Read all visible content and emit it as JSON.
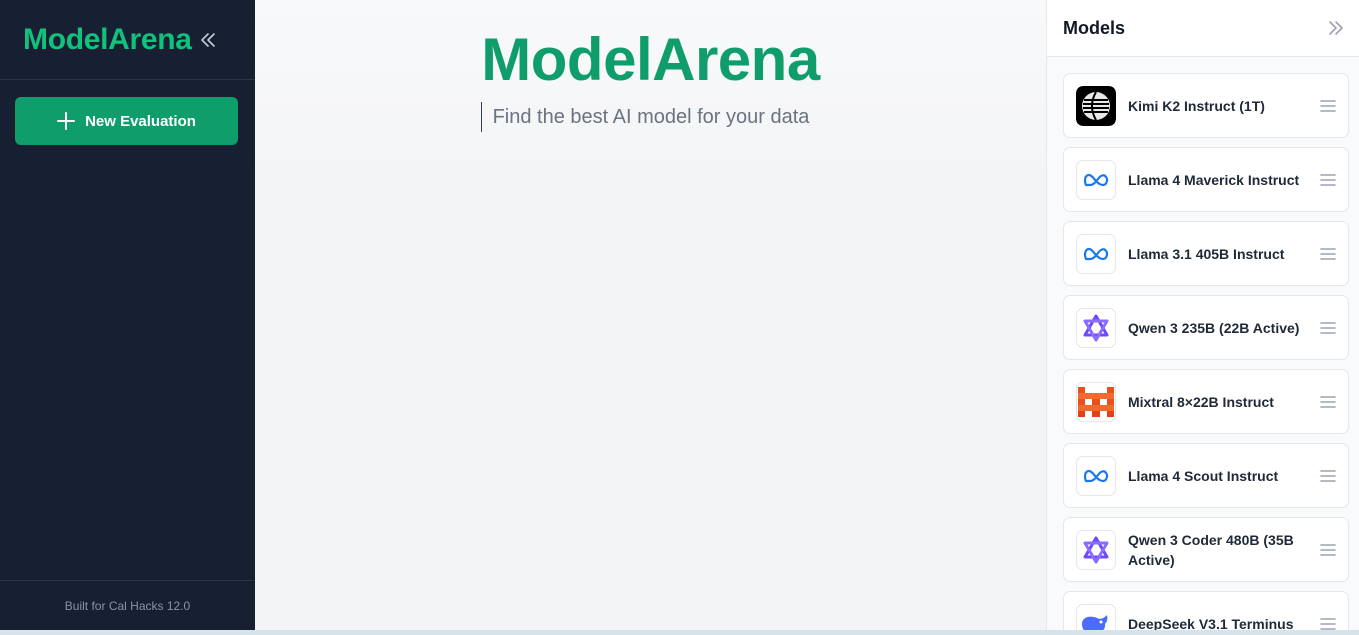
{
  "sidebar": {
    "brand": "ModelArena",
    "new_evaluation_label": "New Evaluation",
    "footer": "Built for Cal Hacks 12.0"
  },
  "main": {
    "title": "ModelArena",
    "search_placeholder": "Find the best AI model for your data"
  },
  "models_panel": {
    "title": "Models",
    "models": [
      {
        "name": "Kimi K2 Instruct (1T)",
        "icon": "kimi-icon"
      },
      {
        "name": "Llama 4 Maverick Instruct",
        "icon": "meta-icon"
      },
      {
        "name": "Llama 3.1 405B Instruct",
        "icon": "meta-icon"
      },
      {
        "name": "Qwen 3 235B (22B Active)",
        "icon": "qwen-icon"
      },
      {
        "name": "Mixtral 8×22B Instruct",
        "icon": "mistral-icon"
      },
      {
        "name": "Llama 4 Scout Instruct",
        "icon": "meta-icon"
      },
      {
        "name": "Qwen 3 Coder 480B (35B Active)",
        "icon": "qwen-icon"
      },
      {
        "name": "DeepSeek V3.1 Terminus",
        "icon": "deepseek-icon"
      }
    ]
  },
  "colors": {
    "sidebar_bg": "#172033",
    "accent": "#0f9d6b",
    "brand_text": "#10c27c"
  }
}
